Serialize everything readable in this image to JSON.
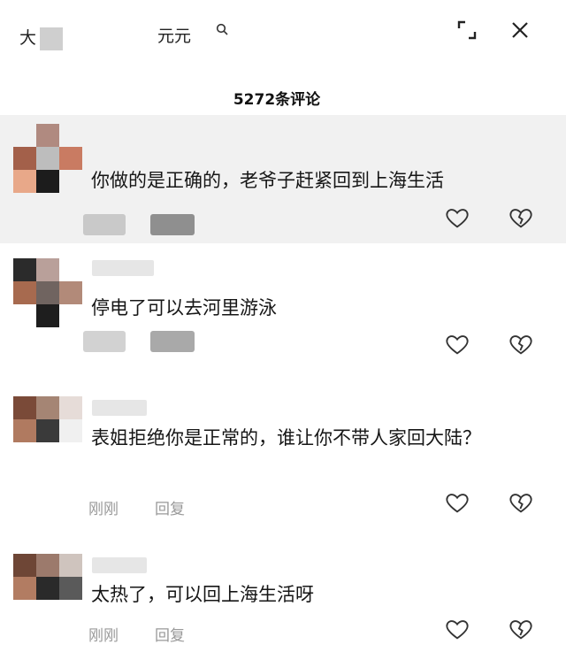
{
  "header": {
    "search_prefix": "大",
    "search_suffix": "元元",
    "comment_count": "5272条评论"
  },
  "comments": [
    {
      "content": "你做的是正确的，老爷子赶紧回到上海生活",
      "time": "",
      "reply": ""
    },
    {
      "content": "停电了可以去河里游泳",
      "time": "",
      "reply": ""
    },
    {
      "content": "表姐拒绝你是正常的，谁让你不带人家回大陆？",
      "time": "刚刚",
      "reply": "回复"
    },
    {
      "content": "太热了，可以回上海生活呀",
      "time": "刚刚",
      "reply": "回复"
    }
  ],
  "icons": [
    "search-icon",
    "expand-icon",
    "close-icon",
    "heart-icon",
    "broken-heart-icon"
  ],
  "colors": {
    "highlight_bg": "#f1f1f1",
    "meta_text": "#999999"
  }
}
